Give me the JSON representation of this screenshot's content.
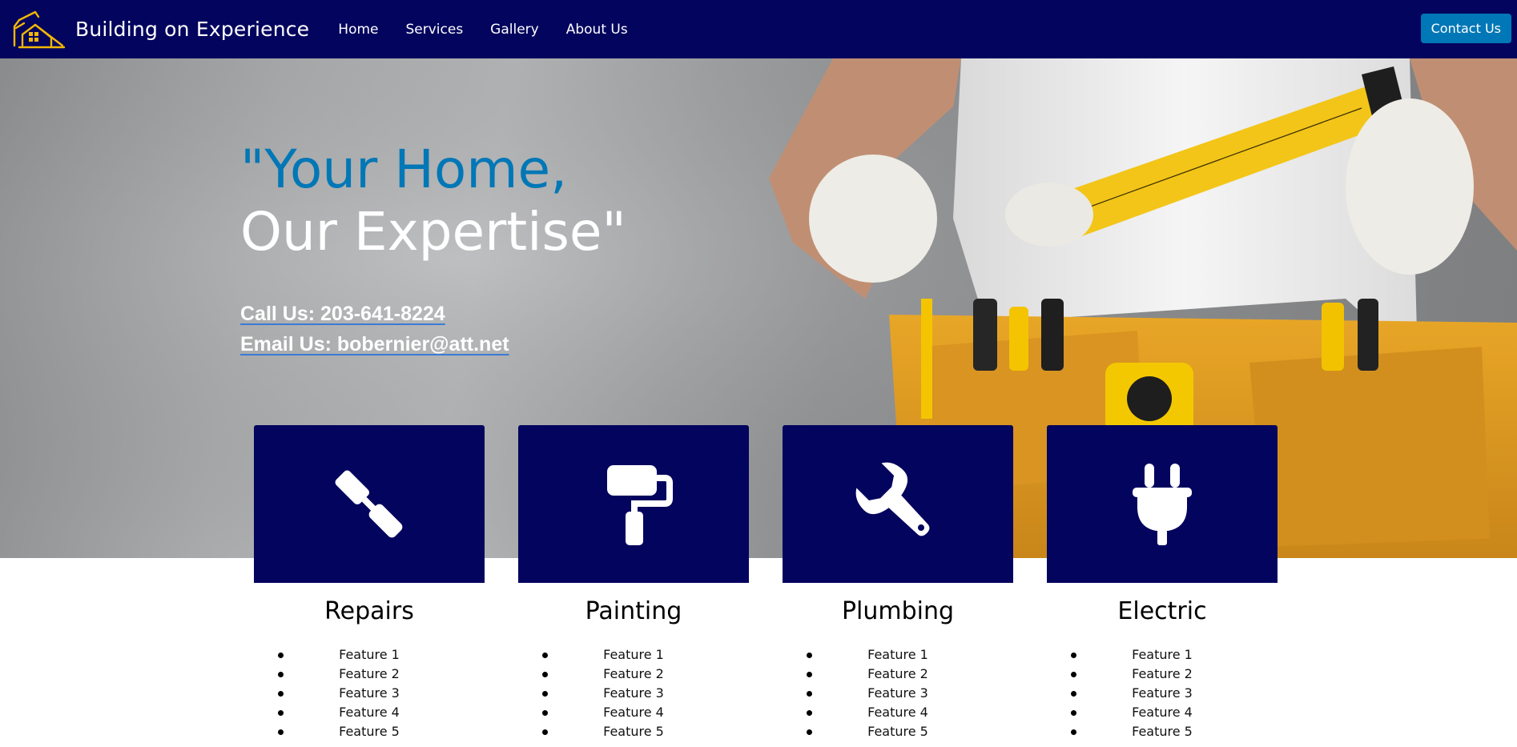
{
  "nav": {
    "brand": "Building on Experience",
    "logo_icon": "house-crane-logo-icon",
    "links": [
      "Home",
      "Services",
      "Gallery",
      "About Us"
    ],
    "contact_button": "Contact Us",
    "background_color": "#03045e",
    "button_color": "#0077b6"
  },
  "hero": {
    "title_line1": "\"Your Home,",
    "title_line2": "Our Expertise\"",
    "call_text": "Call Us: 203-641-8224",
    "email_text": "Email Us: bobernier@att.net",
    "accent_color": "#0077b6"
  },
  "services": [
    {
      "title": "Repairs",
      "icon": "screwdriver-icon",
      "features": [
        "Feature 1",
        "Feature 2",
        "Feature 3",
        "Feature 4",
        "Feature 5"
      ]
    },
    {
      "title": "Painting",
      "icon": "paint-roller-icon",
      "features": [
        "Feature 1",
        "Feature 2",
        "Feature 3",
        "Feature 4",
        "Feature 5"
      ]
    },
    {
      "title": "Plumbing",
      "icon": "wrench-icon",
      "features": [
        "Feature 1",
        "Feature 2",
        "Feature 3",
        "Feature 4",
        "Feature 5"
      ]
    },
    {
      "title": "Electric",
      "icon": "plug-icon",
      "features": [
        "Feature 1",
        "Feature 2",
        "Feature 3",
        "Feature 4",
        "Feature 5"
      ]
    }
  ]
}
